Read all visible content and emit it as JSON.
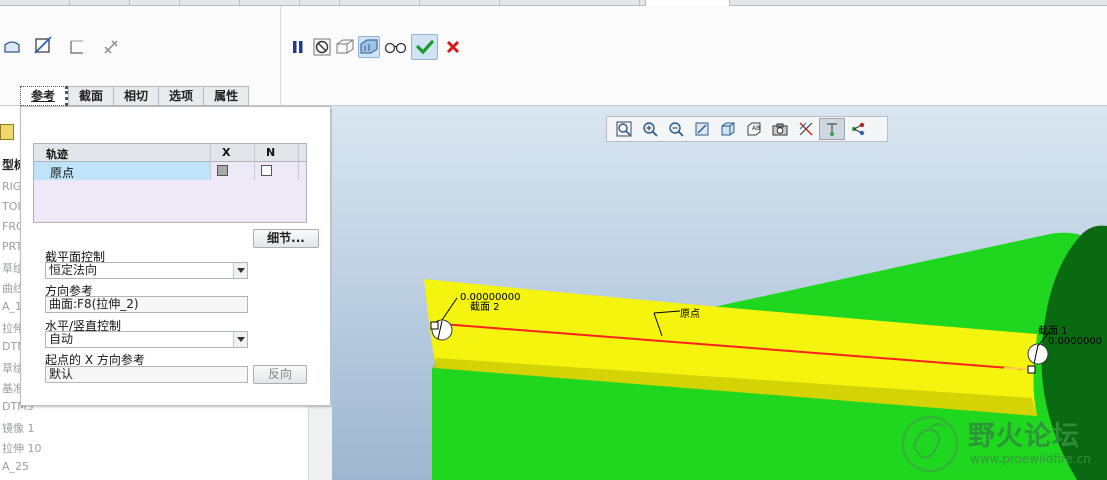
{
  "dashboard": {
    "tabs": [
      "参考",
      "截面",
      "相切",
      "选项",
      "属性"
    ],
    "active_tab": "参考"
  },
  "panel": {
    "trajectory_table": {
      "headers": [
        "轨迹",
        "X",
        "N"
      ],
      "rows": [
        {
          "name": "原点",
          "x": true,
          "n": false
        }
      ]
    },
    "details_button": "细节...",
    "section_plane_control_label": "截平面控制",
    "section_plane_control_value": "恒定法向",
    "direction_reference_label": "方向参考",
    "direction_reference_value": "曲面:F8(拉伸_2)",
    "hv_control_label": "水平/竖直控制",
    "hv_control_value": "自动",
    "start_x_label": "起点的 X 方向参考",
    "start_x_value": "默认",
    "flip_button": "反向"
  },
  "tree": {
    "header": "型树",
    "items": [
      "RIG",
      "TOI",
      "FRO",
      "PRT",
      "草绘",
      "曲线",
      "A_1",
      "拉伸",
      "DTM",
      "草绘",
      "基准",
      "DTM3",
      "镜像 1",
      "拉伸 10",
      "A_25"
    ]
  },
  "viewport": {
    "labels": {
      "section2_value": "0.00000000",
      "section2_name": "截面 2",
      "origin": "原点",
      "section1_name": "截面 1",
      "section1_value": "0.0000000"
    }
  },
  "watermark": {
    "title": "野火论坛",
    "url": "www.proewildfire.cn"
  },
  "icons": {
    "ribbon_left": [
      "sweep-surface-icon",
      "slope-line-icon",
      "corner-icon",
      "arrows-icon"
    ],
    "ribbon_right": [
      "pause-icon",
      "no-preview-icon",
      "verify-3d-icon",
      "preview-geometry-icon",
      "glasses-icon",
      "ok-check-icon",
      "cancel-x-icon"
    ],
    "view_toolbar": [
      "refit-icon",
      "zoom-in-icon",
      "zoom-out-icon",
      "repaint-icon",
      "display-style-icon",
      "saved-views-icon",
      "camera-icon",
      "datum-display-icon",
      "annotation-icon",
      "spin-center-icon"
    ]
  },
  "colors": {
    "accent_green": "#1fd71f",
    "yellow_surface": "#f4f40e",
    "trajectory_red": "#ff2020",
    "confirm_green": "#1a9a2a",
    "cancel_red": "#d61a1a"
  }
}
